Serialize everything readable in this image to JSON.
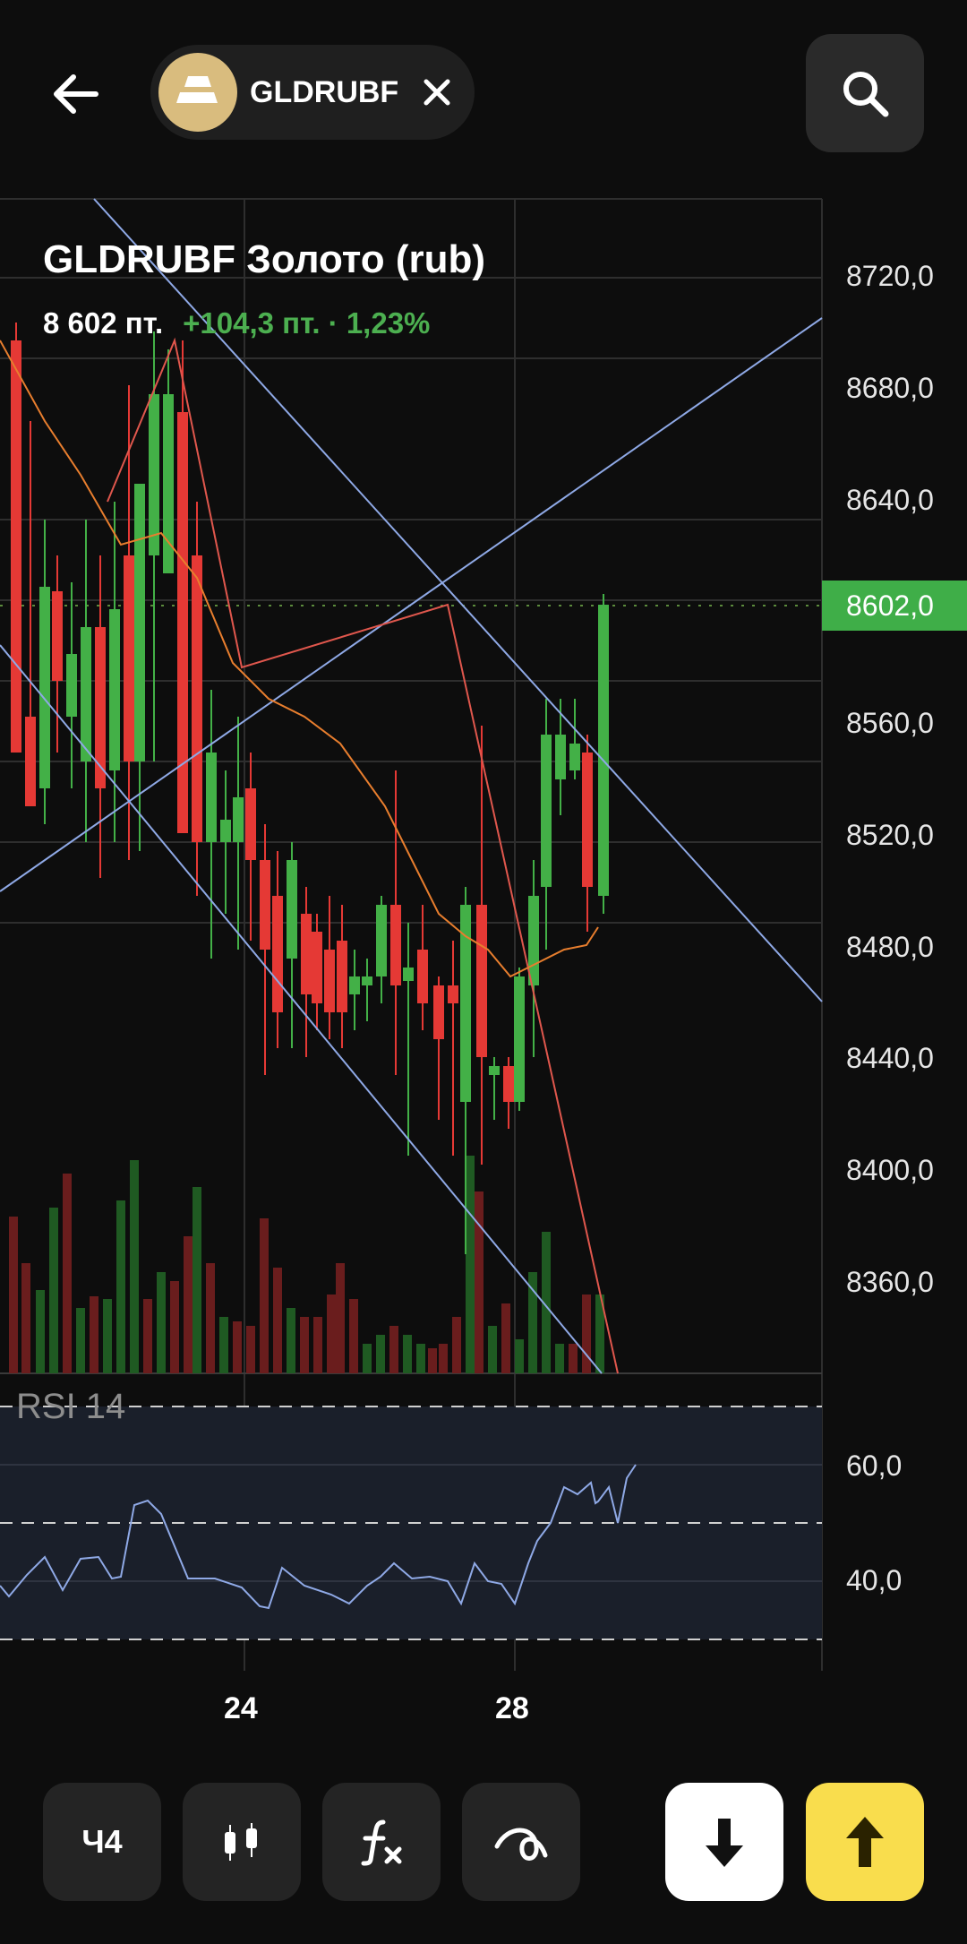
{
  "header": {
    "ticker": "GLDRUBF",
    "colors": {
      "chip_bg": "#1f1f1f",
      "avatar_bg": "#d9bc7e"
    }
  },
  "instrument": {
    "title": "GLDRUBF Золото (rub)",
    "price": "8 602 пт.",
    "change": "+104,3 пт. · 1,23%"
  },
  "price_axis": {
    "labels": [
      "8720,0",
      "8680,0",
      "8640,0",
      "8560,0",
      "8520,0",
      "8480,0",
      "8440,0",
      "8400,0",
      "8360,0"
    ],
    "current_price": "8602,0"
  },
  "rsi": {
    "label": "RSI 14",
    "axis_labels": [
      "60,0",
      "40,0"
    ]
  },
  "x_axis": {
    "dates": [
      "24",
      "28"
    ]
  },
  "toolbar": {
    "timeframe": "Ч4",
    "candles_icon": "candles-icon",
    "indicators_icon": "function-icon",
    "drawing_icon": "drawing-icon",
    "sell_icon": "arrow-down-icon",
    "buy_icon": "arrow-up-icon"
  },
  "colors": {
    "up": "#43b047",
    "down": "#e53935",
    "trend_lines": "#8fa9e6",
    "moving_average": "#e87e2e",
    "buy": "#f9dd4d",
    "sell": "#ffffff",
    "rsi_line": "#8fa9e6"
  }
}
